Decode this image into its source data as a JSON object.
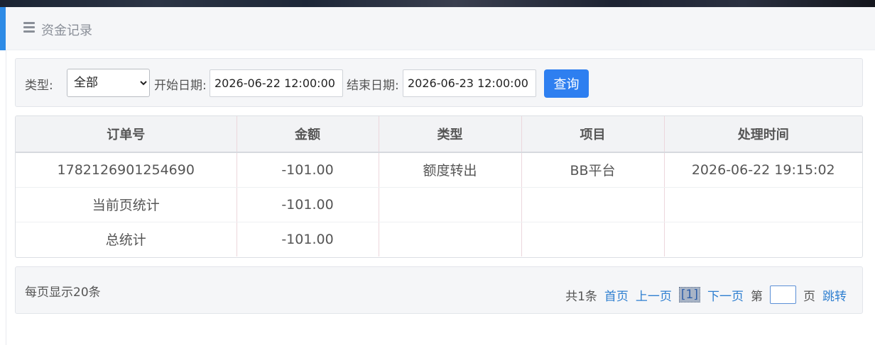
{
  "header": {
    "title": "资金记录"
  },
  "filter": {
    "type_label": "类型:",
    "type_selected": "全部",
    "start_label": "开始日期:",
    "start_value": "2026-06-22 12:00:00",
    "end_label": "结束日期:",
    "end_value": "2026-06-23 12:00:00",
    "query_label": "查询"
  },
  "table": {
    "columns": [
      "订单号",
      "金额",
      "类型",
      "项目",
      "处理时间"
    ],
    "rows": [
      [
        "1782126901254690",
        "-101.00",
        "额度转出",
        "BB平台",
        "2026-06-22 19:15:02"
      ],
      [
        "当前页统计",
        "-101.00",
        "",
        "",
        ""
      ],
      [
        "总统计",
        "-101.00",
        "",
        "",
        ""
      ]
    ]
  },
  "footer": {
    "per_page": "每页显示20条",
    "total": "共1条",
    "first": "首页",
    "prev": "上一页",
    "current": "[1]",
    "next": "下一页",
    "goto_prefix": "第",
    "goto_suffix": "页",
    "jump": "跳转"
  },
  "colors": {
    "accent": "#2e8be6",
    "button": "#2e7ff0",
    "link": "#2e7fd0"
  },
  "icons": {
    "header_icon": "menu-icon",
    "select_icon": "chevron-down-icon"
  }
}
